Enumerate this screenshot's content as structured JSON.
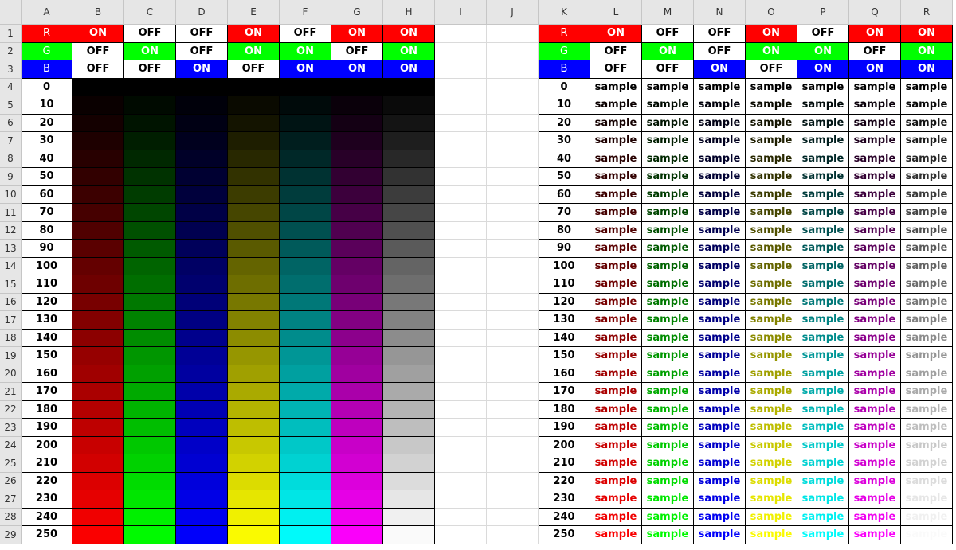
{
  "column_headers": [
    "A",
    "B",
    "C",
    "D",
    "E",
    "F",
    "G",
    "H",
    "I",
    "J",
    "K",
    "L",
    "M",
    "N",
    "O",
    "P",
    "Q",
    "R"
  ],
  "row_numbers": [
    "1",
    "2",
    "3",
    "4",
    "5",
    "6",
    "7",
    "8",
    "9",
    "10",
    "11",
    "12",
    "13",
    "14",
    "15",
    "16",
    "17",
    "18",
    "19",
    "20",
    "21",
    "22",
    "23",
    "24",
    "25",
    "26",
    "27",
    "28",
    "29"
  ],
  "channel_labels": [
    "R",
    "G",
    "B"
  ],
  "channel_colors": [
    "#ff0000",
    "#00ff00",
    "#0000ff"
  ],
  "switch_rows": [
    [
      "ON",
      "OFF",
      "OFF",
      "ON",
      "OFF",
      "ON",
      "ON"
    ],
    [
      "OFF",
      "ON",
      "OFF",
      "ON",
      "ON",
      "OFF",
      "ON"
    ],
    [
      "OFF",
      "OFF",
      "ON",
      "OFF",
      "ON",
      "ON",
      "ON"
    ]
  ],
  "levels": [
    "0",
    "10",
    "20",
    "30",
    "40",
    "50",
    "60",
    "70",
    "80",
    "90",
    "100",
    "110",
    "120",
    "130",
    "140",
    "150",
    "160",
    "170",
    "180",
    "190",
    "200",
    "210",
    "220",
    "230",
    "240",
    "250"
  ],
  "sample_text": "sample"
}
